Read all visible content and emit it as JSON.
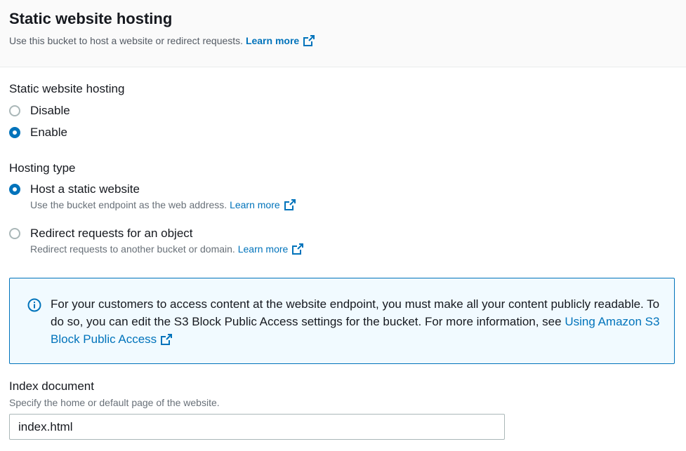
{
  "header": {
    "title": "Static website hosting",
    "subtitle": "Use this bucket to host a website or redirect requests.",
    "learn_more": "Learn more"
  },
  "hosting": {
    "label": "Static website hosting",
    "options": [
      {
        "label": "Disable",
        "checked": false
      },
      {
        "label": "Enable",
        "checked": true
      }
    ]
  },
  "hosting_type": {
    "label": "Hosting type",
    "options": [
      {
        "label": "Host a static website",
        "description": "Use the bucket endpoint as the web address.",
        "learn_more": "Learn more",
        "checked": true
      },
      {
        "label": "Redirect requests for an object",
        "description": "Redirect requests to another bucket or domain.",
        "learn_more": "Learn more",
        "checked": false
      }
    ]
  },
  "info": {
    "text": "For your customers to access content at the website endpoint, you must make all your content publicly readable. To do so, you can edit the S3 Block Public Access settings for the bucket. For more information, see",
    "link": "Using Amazon S3 Block Public Access"
  },
  "index_document": {
    "label": "Index document",
    "description": "Specify the home or default page of the website.",
    "value": "index.html"
  },
  "colors": {
    "link": "#0073bb",
    "info_bg": "#f1faff",
    "info_border": "#0073bb"
  }
}
